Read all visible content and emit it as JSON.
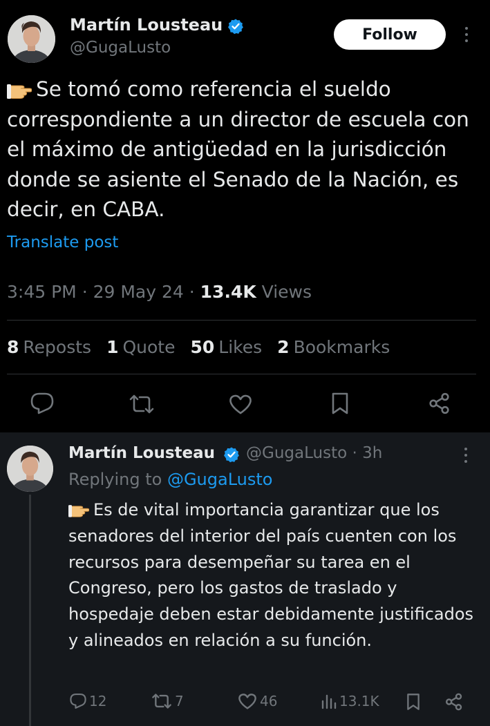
{
  "main_tweet": {
    "author_name": "Martín Lousteau",
    "handle": "@GugaLusto",
    "follow_label": "Follow",
    "emoji": "👉",
    "text": "Se tomó como referencia el sueldo correspondiente a un director de escuela con el máximo de antigüedad en la jurisdicción donde se asiente el Senado de la Nación, es decir, en CABA.",
    "translate_label": "Translate post",
    "time": "3:45 PM",
    "date": "29 May 24",
    "separator": "·",
    "views_count": "13.4K",
    "views_label": "Views",
    "stats": [
      {
        "count": "8",
        "label": "Reposts"
      },
      {
        "count": "1",
        "label": "Quote"
      },
      {
        "count": "50",
        "label": "Likes"
      },
      {
        "count": "2",
        "label": "Bookmarks"
      }
    ],
    "actions": [
      "reply-icon",
      "repost-icon",
      "like-icon",
      "bookmark-icon",
      "share-icon"
    ]
  },
  "reply_tweet": {
    "author_name": "Martín Lousteau",
    "handle": "@GugaLusto",
    "time_ago": "3h",
    "separator": "·",
    "replying_prefix": "Replying to",
    "replying_to": "@GugaLusto",
    "emoji": "👉",
    "text": "Es de vital importancia garantizar que los senadores del interior del país cuenten con los recursos para desempeñar su tarea en el Congreso, pero los gastos de traslado y hospedaje deben estar debidamente justificados y alineados en relación a su función.",
    "replies": "12",
    "reposts": "7",
    "likes": "46",
    "views": "13.1K"
  },
  "colors": {
    "background": "#000000",
    "reply_background": "#15181c",
    "text": "#e7e9ea",
    "muted": "#71767b",
    "link": "#1d9bf0",
    "verified": "#1d9bf0"
  }
}
